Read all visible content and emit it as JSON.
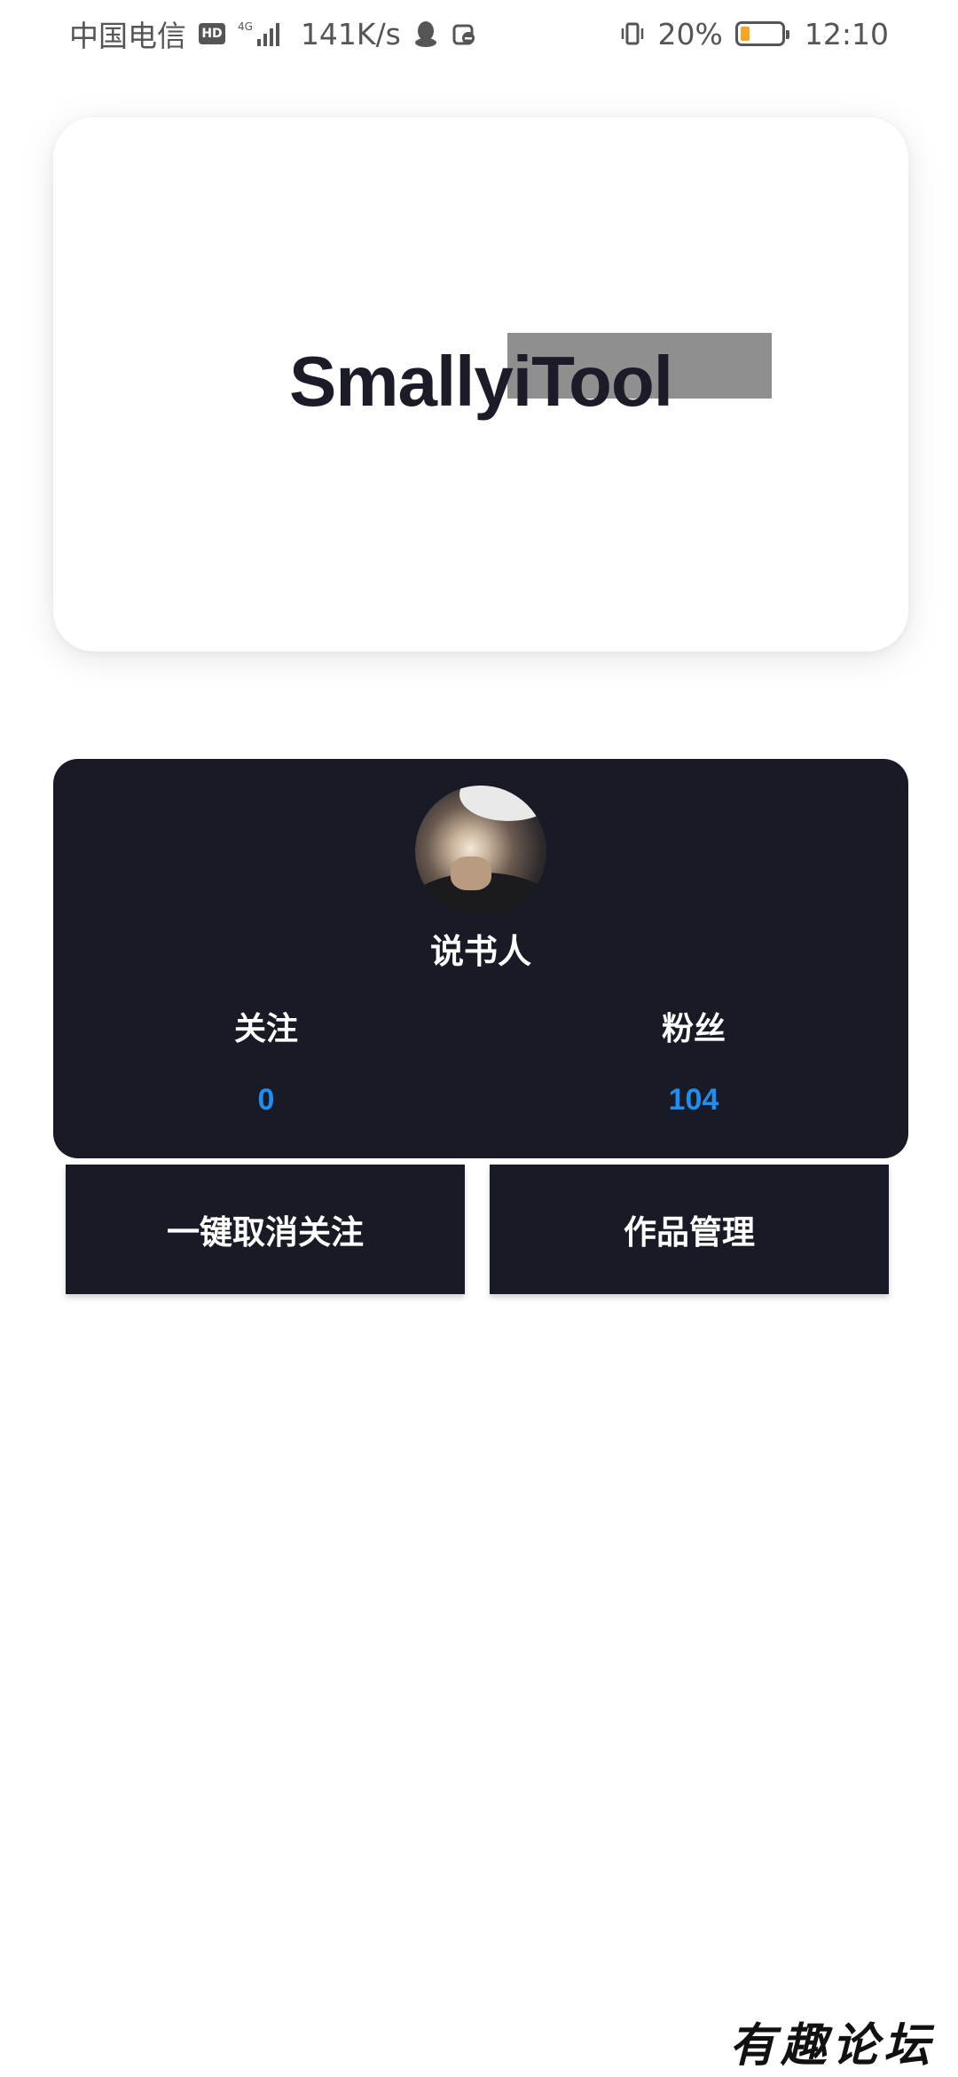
{
  "status_bar": {
    "carrier": "中国电信",
    "hd": "HD",
    "network": "4G",
    "speed": "141K/s",
    "battery_percent": "20%",
    "battery_level": 0.2,
    "time": "12:10"
  },
  "banner": {
    "title": "SmallyiTool"
  },
  "profile": {
    "username": "说书人",
    "following_label": "关注",
    "following_count": "0",
    "followers_label": "粉丝",
    "followers_count": "104"
  },
  "actions": {
    "unfollow_all_label": "一键取消关注",
    "manage_works_label": "作品管理"
  },
  "watermark": "有趣论坛",
  "colors": {
    "card_dark": "#181a26",
    "accent_blue": "#1e8ff0",
    "battery_low": "#f5a623"
  }
}
